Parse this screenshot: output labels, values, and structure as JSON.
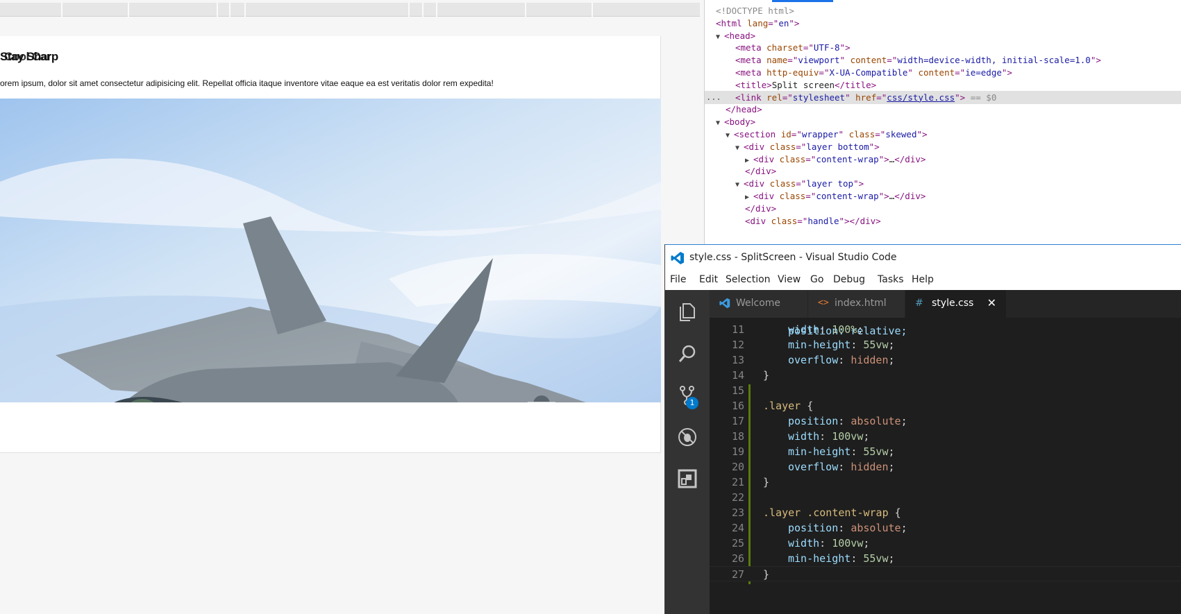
{
  "browser": {
    "page_title": "Stay Sharp",
    "page_title_overlap": "Cool Car",
    "page_text": "orem ipsum, dolor sit amet consectetur adipisicing elit. Repellat officia itaque inventore vitae eaque ea est veritatis dolor rem expedita!"
  },
  "devtools": {
    "lines": [
      {
        "html": "<span class='dt-gray'>&lt;!DOCTYPE html&gt;</span>"
      },
      {
        "html": "&lt;html <span class='dt-attr'>lang</span>=\"<span class='dt-val'>en</span>\"&gt;"
      },
      {
        "html": "<span class='dt-tri'>▼</span>&lt;head&gt;"
      },
      {
        "html": "&lt;meta <span class='dt-attr'>charset</span>=\"<span class='dt-val'>UTF-8</span>\"&gt;"
      },
      {
        "html": "&lt;meta <span class='dt-attr'>name</span>=\"<span class='dt-val'>viewport</span>\" <span class='dt-attr'>content</span>=\"<span class='dt-val'>width=device-width, initial-scale=1.0</span>\"&gt;"
      },
      {
        "html": "&lt;meta <span class='dt-attr'>http-equiv</span>=\"<span class='dt-val'>X-UA-Compatible</span>\" <span class='dt-attr'>content</span>=\"<span class='dt-val'>ie=edge</span>\"&gt;"
      },
      {
        "html": "&lt;title&gt;<span class='dt-txt'>Split screen</span>&lt;/title&gt;"
      },
      {
        "html": "&lt;link <span class='dt-attr'>rel</span>=\"<span class='dt-val'>stylesheet</span>\" <span class='dt-attr'>href</span>=\"<span class='dt-link'>css/style.css</span>\"&gt; <span class='dt-gray'>== $0</span>"
      },
      {
        "html": "&lt;/head&gt;"
      },
      {
        "html": "<span class='dt-tri'>▼</span>&lt;body&gt;"
      },
      {
        "html": "<span class='dt-tri'>▼</span>&lt;section <span class='dt-attr'>id</span>=\"<span class='dt-val'>wrapper</span>\" <span class='dt-attr'>class</span>=\"<span class='dt-val'>skewed</span>\"&gt;"
      },
      {
        "html": "<span class='dt-tri'>▼</span>&lt;div <span class='dt-attr'>class</span>=\"<span class='dt-val'>layer bottom</span>\"&gt;"
      },
      {
        "html": "<span class='dt-tri'>▶</span>&lt;div <span class='dt-attr'>class</span>=\"<span class='dt-val'>content-wrap</span>\"&gt;<span class='dt-txt'>…</span>&lt;/div&gt;"
      },
      {
        "html": "&lt;/div&gt;"
      },
      {
        "html": "<span class='dt-tri'>▼</span>&lt;div <span class='dt-attr'>class</span>=\"<span class='dt-val'>layer top</span>\"&gt;"
      },
      {
        "html": "<span class='dt-tri'>▶</span>&lt;div <span class='dt-attr'>class</span>=\"<span class='dt-val'>content-wrap</span>\"&gt;<span class='dt-txt'>…</span>&lt;/div&gt;"
      },
      {
        "html": "&lt;/div&gt;"
      },
      {
        "html": "&lt;div <span class='dt-attr'>class</span>=\"<span class='dt-val'>handle</span>\"&gt;&lt;/div&gt;"
      }
    ],
    "selected_marker": "..."
  },
  "vscode": {
    "title": "style.css - SplitScreen - Visual Studio Code",
    "menu": [
      "File",
      "Edit",
      "Selection",
      "View",
      "Go",
      "Debug",
      "Tasks",
      "Help"
    ],
    "tabs": [
      {
        "label": "Welcome",
        "icon": "vscode-logo-icon"
      },
      {
        "label": "index.html",
        "icon": "html-file-icon"
      },
      {
        "label": "style.css",
        "icon": "css-file-icon",
        "active": true
      }
    ],
    "tab_close": "✕",
    "scm_badge": "1",
    "code_partial_top": "position: relative;",
    "code": [
      {
        "n": "11",
        "indent": 2,
        "prop": "width",
        "val": "100%",
        "kind": "num"
      },
      {
        "n": "12",
        "indent": 2,
        "prop": "min-height",
        "val": "55vw",
        "kind": "num"
      },
      {
        "n": "13",
        "indent": 2,
        "prop": "overflow",
        "val": "hidden",
        "kind": "str"
      },
      {
        "n": "14",
        "indent": 1,
        "raw": "}"
      },
      {
        "n": "15",
        "raw": ""
      },
      {
        "n": "16",
        "indent": 1,
        "selector": ".layer",
        "raw": " {"
      },
      {
        "n": "17",
        "indent": 2,
        "prop": "position",
        "val": "absolute",
        "kind": "str"
      },
      {
        "n": "18",
        "indent": 2,
        "prop": "width",
        "val": "100vw",
        "kind": "num"
      },
      {
        "n": "19",
        "indent": 2,
        "prop": "min-height",
        "val": "55vw",
        "kind": "num"
      },
      {
        "n": "20",
        "indent": 2,
        "prop": "overflow",
        "val": "hidden",
        "kind": "str"
      },
      {
        "n": "21",
        "indent": 1,
        "raw": "}"
      },
      {
        "n": "22",
        "raw": ""
      },
      {
        "n": "23",
        "indent": 1,
        "selector": ".layer .content-wrap",
        "raw": " {"
      },
      {
        "n": "24",
        "indent": 2,
        "prop": "position",
        "val": "absolute",
        "kind": "str"
      },
      {
        "n": "25",
        "indent": 2,
        "prop": "width",
        "val": "100vw",
        "kind": "num"
      },
      {
        "n": "26",
        "indent": 2,
        "prop": "min-height",
        "val": "55vw",
        "kind": "num"
      },
      {
        "n": "27",
        "indent": 1,
        "raw": "}"
      }
    ]
  },
  "colors": {
    "vscode_bg": "#1e1e1e",
    "activity_bar": "#333333",
    "accent_blue": "#007acc",
    "git_modified": "#587c0c"
  }
}
